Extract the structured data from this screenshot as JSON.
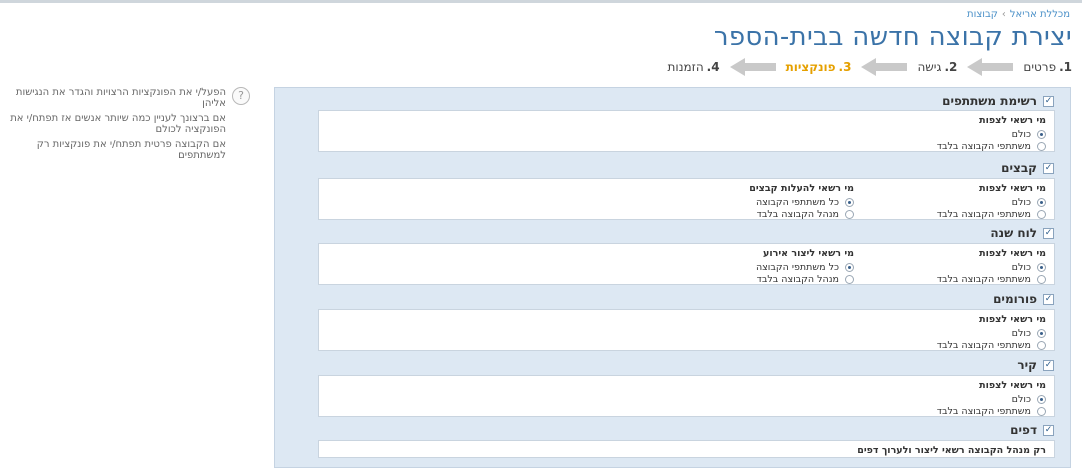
{
  "breadcrumb": [
    "מכללת אריאל",
    "קבוצות"
  ],
  "breadcrumb_separator": "›",
  "page_title": "יצירת קבוצה חדשה בבית-הספר",
  "wizard": {
    "steps": [
      {
        "num": "1.",
        "label": "פרטים",
        "active": false
      },
      {
        "num": "2.",
        "label": "גישה",
        "active": false
      },
      {
        "num": "3.",
        "label": "פונקציות",
        "active": true
      },
      {
        "num": "4.",
        "label": "הזמנות",
        "active": false
      }
    ],
    "active_color": "#e5a000"
  },
  "help": {
    "icon": "question-circle-icon",
    "p1": "הפעל/י את הפונקציות הרצויות והגדר את הנגישות אליהן",
    "p2": "אם ברצונך לעניין כמה שיותר אנשים אז תפתח/י את הפונקציה לכולם",
    "p3": "אם הקבוצה פרטית תפתח/י את פונקציות רק למשתתפים"
  },
  "sections": {
    "participants": {
      "title": "רשימת משתתפים",
      "checked": true,
      "view": {
        "title": "מי רשאי לצפות",
        "options": [
          "כולם",
          "משתתפי הקבוצה בלבד"
        ],
        "selected": 0
      }
    },
    "files": {
      "title": "קבצים",
      "checked": true,
      "view": {
        "title": "מי רשאי לצפות",
        "options": [
          "כולם",
          "משתתפי הקבוצה בלבד"
        ],
        "selected": 0
      },
      "upload": {
        "title": "מי רשאי להעלות קבצים",
        "options": [
          "כל משתתפי הקבוצה",
          "מנהל הקבוצה בלבד"
        ],
        "selected": 0
      }
    },
    "calendar": {
      "title": "לוח שנה",
      "checked": true,
      "view": {
        "title": "מי רשאי לצפות",
        "options": [
          "כולם",
          "משתתפי הקבוצה בלבד"
        ],
        "selected": 0
      },
      "create": {
        "title": "מי רשאי ליצור אירוע",
        "options": [
          "כל משתתפי הקבוצה",
          "מנהל הקבוצה בלבד"
        ],
        "selected": 0
      }
    },
    "forums": {
      "title": "פורומים",
      "checked": true,
      "view": {
        "title": "מי רשאי לצפות",
        "options": [
          "כולם",
          "משתתפי הקבוצה בלבד"
        ],
        "selected": 0
      }
    },
    "wall": {
      "title": "קיר",
      "checked": true,
      "view": {
        "title": "מי רשאי לצפות",
        "options": [
          "כולם",
          "משתתפי הקבוצה בלבד"
        ],
        "selected": 0
      }
    },
    "pages": {
      "title": "דפים",
      "checked": true,
      "note": "רק מנהל הקבוצה רשאי ליצור ולערוך דפים"
    }
  }
}
